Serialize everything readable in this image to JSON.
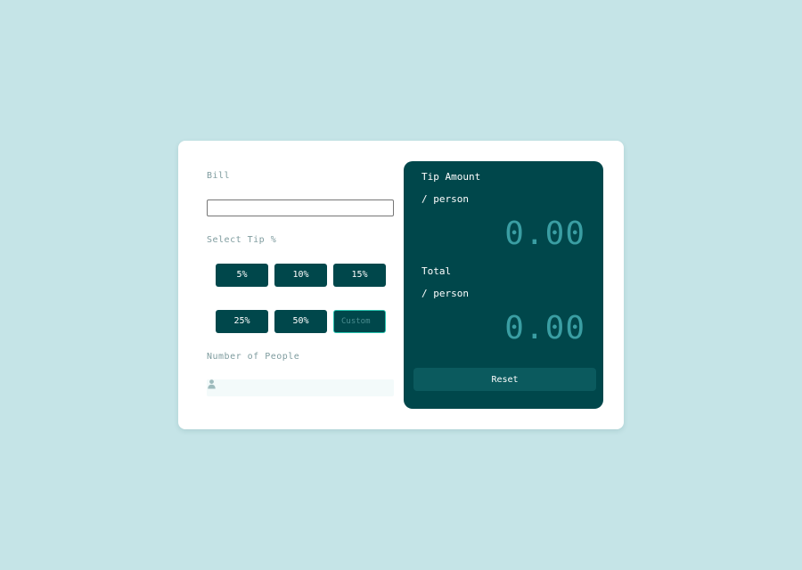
{
  "form": {
    "bill_label": "Bill",
    "bill_value": "",
    "tip_label": "Select Tip %",
    "tip_options": [
      "5%",
      "10%",
      "15%",
      "25%",
      "50%"
    ],
    "custom_placeholder": "Custom",
    "people_label": "Number of People",
    "people_value": "",
    "people_icon": "person-icon"
  },
  "results": {
    "tip_title": "Tip Amount",
    "tip_sub": "/ person",
    "tip_value": "0.00",
    "total_title": "Total",
    "total_sub": "/ person",
    "total_value": "0.00",
    "reset_label": "Reset"
  },
  "colors": {
    "background": "#c5e4e7",
    "panel": "#00474b",
    "amount": "#3a9ea3",
    "label": "#7f9c9f"
  }
}
